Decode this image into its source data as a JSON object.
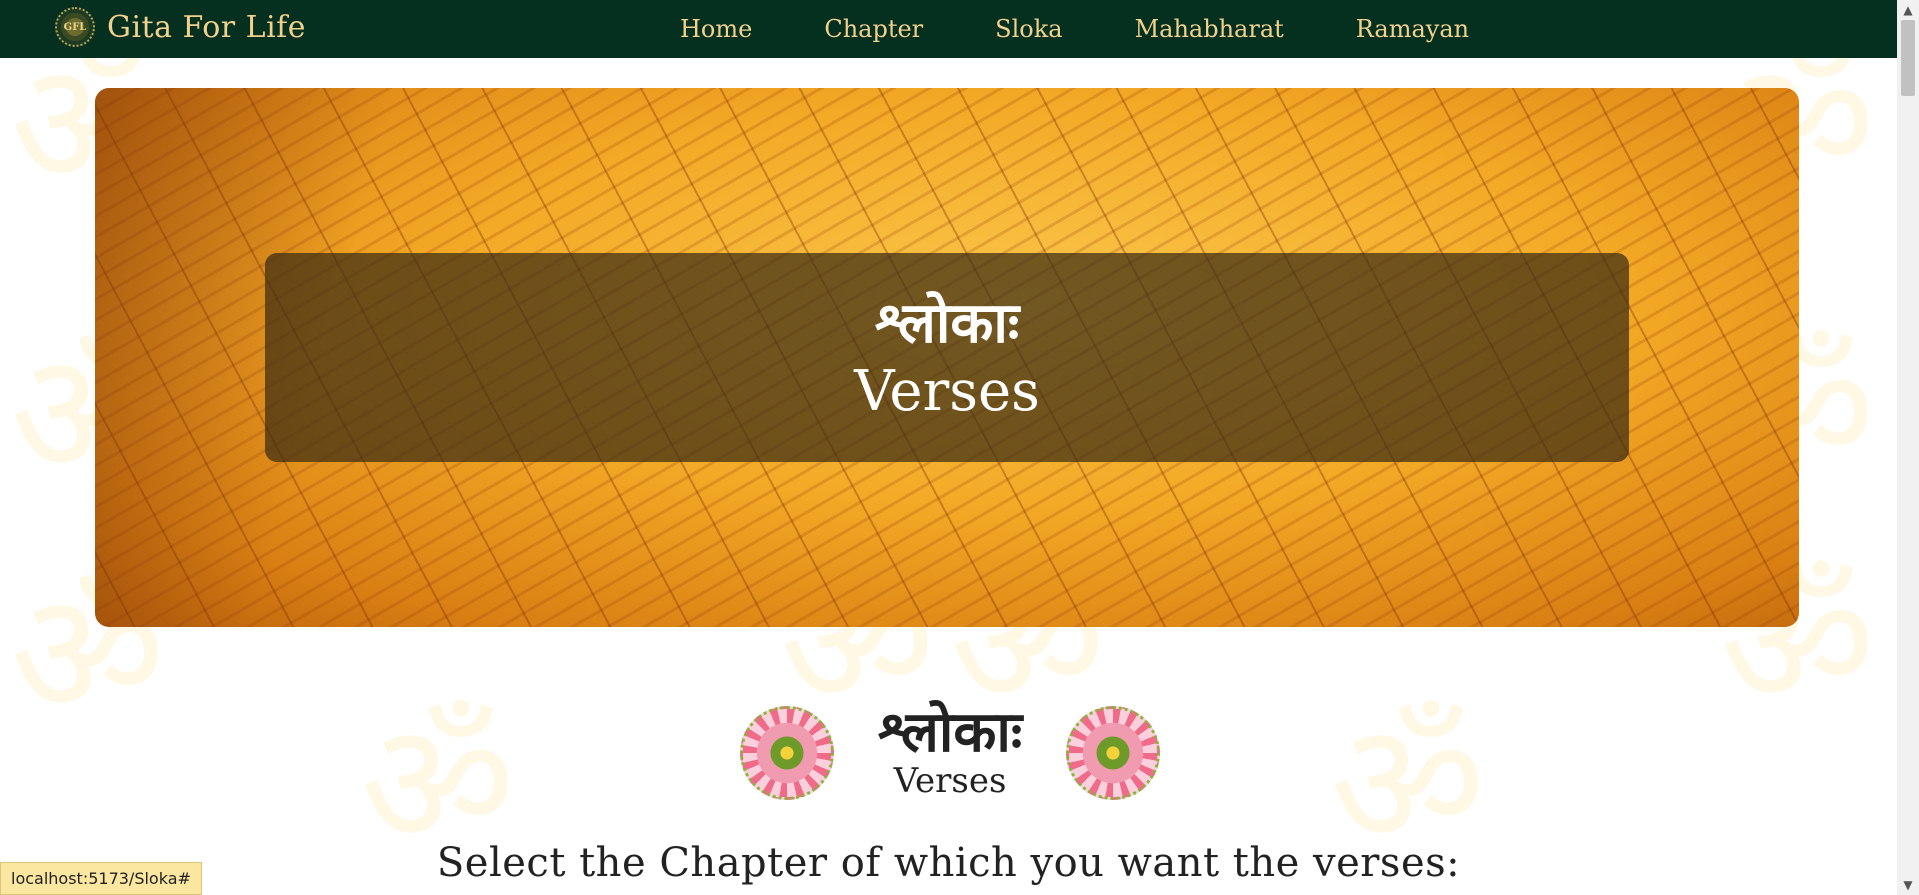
{
  "navbar": {
    "logo_text": "GFL",
    "brand_name": "Gita For Life",
    "links": [
      "Home",
      "Chapter",
      "Sloka",
      "Mahabharat",
      "Ramayan"
    ]
  },
  "hero": {
    "title_sanskrit": "श्लोकाः",
    "title_english": "Verses"
  },
  "section": {
    "title_sanskrit": "श्लोकाः",
    "title_english": "Verses",
    "prompt": "Select the Chapter of which you want the verses:"
  },
  "status_bar": {
    "url": "localhost:5173/Sloka#"
  },
  "colors": {
    "navbar_bg": "#053020",
    "nav_text": "#f2d18c",
    "hero_overlay": "#3c2d14"
  }
}
